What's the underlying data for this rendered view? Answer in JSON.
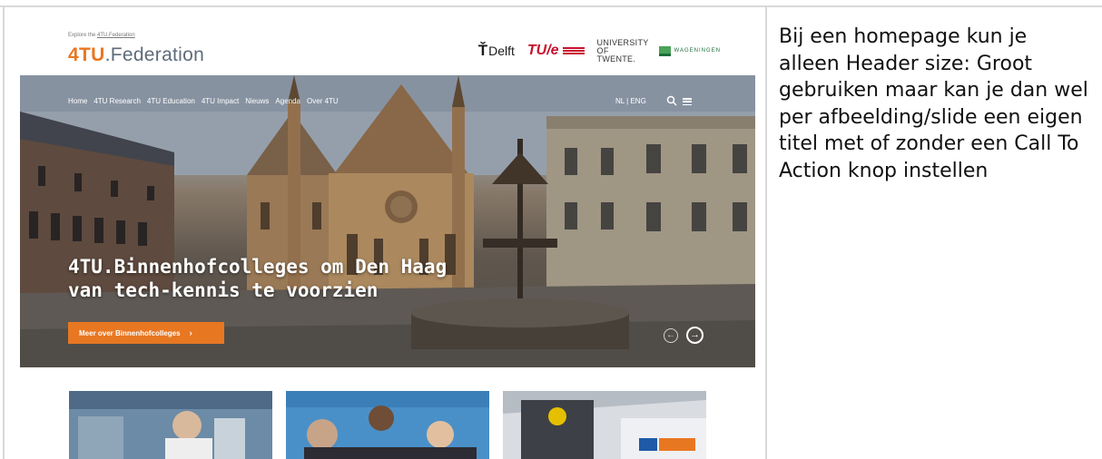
{
  "header": {
    "explore_prefix": "Explore the ",
    "explore_link": "4TU.Federation",
    "logo_prefix": "4TU",
    "logo_suffix": ".Federation"
  },
  "partners": {
    "delft": "Delft",
    "tue": "TU/e",
    "twente": "UNIVERSITY OF TWENTE.",
    "wageningen": "WAGENINGEN"
  },
  "nav": {
    "items": [
      "Home",
      "4TU Research",
      "4TU Education",
      "4TU Impact",
      "Nieuws",
      "Agenda",
      "Over 4TU"
    ],
    "lang": "NL | ENG"
  },
  "hero": {
    "title_line1": "4TU.Binnenhofcolleges om Den Haag",
    "title_line2": "van tech-kennis te voorzien",
    "cta_label": "Meer over Binnenhofcolleges",
    "cta_arrow": "›",
    "prev_glyph": "←",
    "next_glyph": "→"
  },
  "annotation": {
    "text": "Bij een homepage kun je alleen Header size: Groot gebruiken maar kan je dan wel per afbeelding/slide een eigen titel met of zonder een Call To Action knop instellen"
  },
  "colors": {
    "brand_orange": "#e87722",
    "logo_gray": "#5f6b7a",
    "tue_red": "#c8102e",
    "wur_green": "#4aa35a"
  },
  "icons": [
    "search-icon",
    "menu-icon",
    "arrow-left-icon",
    "arrow-right-icon"
  ]
}
